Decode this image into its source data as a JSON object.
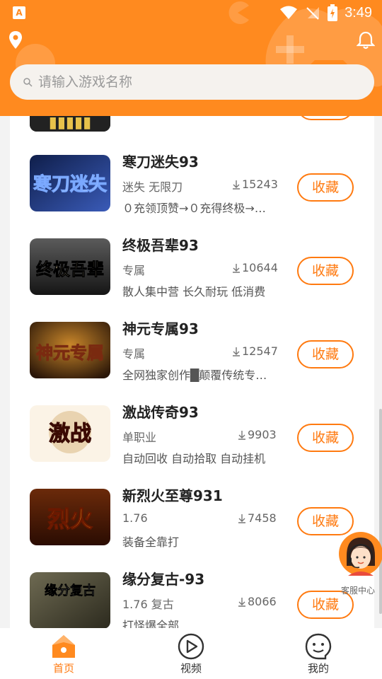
{
  "status_bar": {
    "time": "3:49",
    "app_icon_letter": "A"
  },
  "search": {
    "placeholder": "请输入游戏名称"
  },
  "games": [
    {
      "name": "寒刀迷失93",
      "tags": "迷失 无限刀",
      "downloads": "15243",
      "desc": "０充领顶赞→０充得终极→…",
      "fav_label": "收藏",
      "thumb_title": "寒刀迷失"
    },
    {
      "name": "终极吾辈93",
      "tags": "专属",
      "downloads": "10644",
      "desc": "散人集中营 长久耐玩 低消费",
      "fav_label": "收藏",
      "thumb_title": "终极吾辈"
    },
    {
      "name": "神元专属93",
      "tags": "专属",
      "downloads": "12547",
      "desc": "全网独家创作█颠覆传统专…",
      "fav_label": "收藏",
      "thumb_title": "神元专属"
    },
    {
      "name": "激战传奇93",
      "tags": "单职业",
      "downloads": "9903",
      "desc": "自动回收 自动拾取 自动挂机",
      "fav_label": "收藏",
      "thumb_title": "激战"
    },
    {
      "name": "新烈火至尊931",
      "tags": "1.76",
      "downloads": "7458",
      "desc": "装备全靠打",
      "fav_label": "收藏",
      "thumb_title": "烈火"
    },
    {
      "name": "缘分复古-93",
      "tags": "1.76 复古",
      "downloads": "8066",
      "desc": "打怪爆全部",
      "fav_label": "收藏",
      "thumb_title": "缘分复古"
    }
  ],
  "customer_service": {
    "label": "客服中心"
  },
  "tabs": [
    {
      "label": "首页",
      "icon": "home-icon",
      "active": true
    },
    {
      "label": "视频",
      "icon": "play-icon",
      "active": false
    },
    {
      "label": "我的",
      "icon": "face-icon",
      "active": false
    }
  ],
  "colors": {
    "brand": "#ff8a1f",
    "accent": "#ff7a10"
  }
}
